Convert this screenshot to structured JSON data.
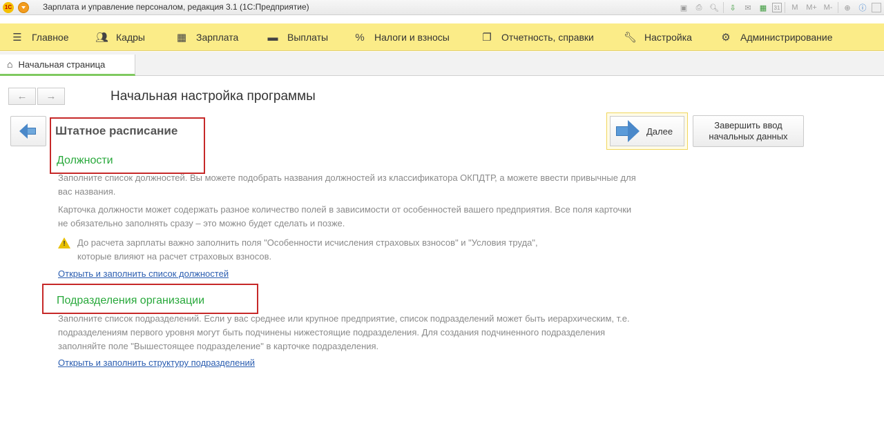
{
  "titlebar": {
    "logo_text": "1С",
    "title": "Зарплата и управление персоналом, редакция 3.1  (1С:Предприятие)",
    "buttons": {
      "m": "M",
      "m_plus": "M+",
      "m_minus": "M-",
      "calendar_day": "31"
    }
  },
  "panel": {
    "items": [
      {
        "label": "Главное",
        "icon": "hamburger-icon"
      },
      {
        "label": "Кадры",
        "icon": "people-icon"
      },
      {
        "label": "Зарплата",
        "icon": "calculator-icon"
      },
      {
        "label": "Выплаты",
        "icon": "wallet-icon"
      },
      {
        "label": "Налоги и взносы",
        "icon": "percent-icon"
      },
      {
        "label": "Отчетность, справки",
        "icon": "reports-icon"
      },
      {
        "label": "Настройка",
        "icon": "wrench-icon"
      },
      {
        "label": "Администрирование",
        "icon": "gear-icon"
      }
    ]
  },
  "tabs": {
    "home": "Начальная страница"
  },
  "page": {
    "title": "Начальная настройка программы",
    "next_label": "Далее",
    "finish_label": "Завершить ввод\nначальных данных",
    "section_title": "Штатное расписание",
    "positions": {
      "title": "Должности",
      "p1": "Заполните список должностей. Вы можете подобрать названия должностей из классификатора ОКПДТР, а можете ввести привычные для вас названия.",
      "p2": "Карточка должности может содержать разное количество полей в зависимости от особенностей вашего предприятия. Все поля карточки не обязательно заполнять сразу – это можно будет сделать и позже.",
      "warning": "До расчета зарплаты важно заполнить поля \"Особенности исчисления страховых взносов\" и \"Условия труда\", которые влияют на расчет страховых взносов.",
      "link": "Открыть и заполнить список должностей"
    },
    "departments": {
      "title": "Подразделения организации",
      "p1": "Заполните список подразделений. Если у вас среднее или крупное предприятие, список подразделений может быть иерархическим, т.е. подразделениям первого уровня могут быть подчинены нижестоящие подразделения. Для создания подчиненного подразделения заполняйте поле \"Вышестоящее подразделение\" в карточке подразделения.",
      "link": "Открыть и заполнить структуру подразделений"
    }
  }
}
